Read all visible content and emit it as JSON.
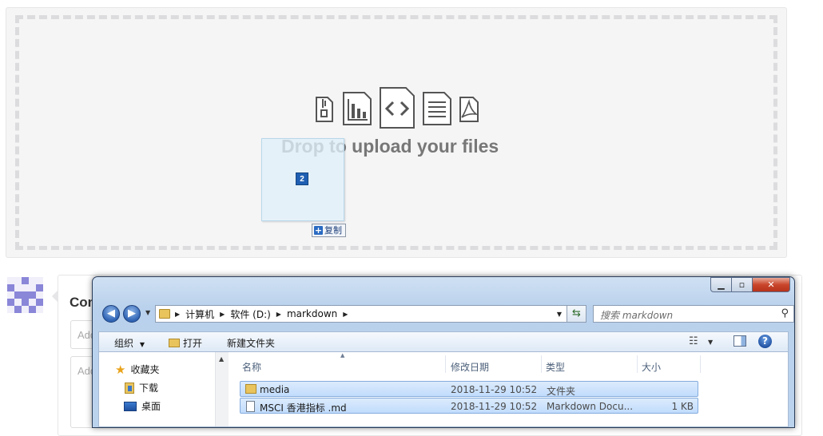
{
  "upload": {
    "drop_text": "Drop to upload your files",
    "drag_count": "2",
    "drag_action": "复制",
    "file_icons": [
      "zip-file-icon",
      "chart-file-icon",
      "code-file-icon",
      "text-file-icon",
      "pdf-file-icon"
    ]
  },
  "commit": {
    "title": "Commit changes",
    "summary_placeholder": "Add",
    "description_placeholder": "Add"
  },
  "explorer": {
    "breadcrumbs": [
      "计算机",
      "软件 (D:)",
      "markdown"
    ],
    "search_placeholder": "搜索 markdown",
    "toolbar": {
      "organize": "组织",
      "open": "打开",
      "new_folder": "新建文件夹"
    },
    "nav": {
      "favorites": "收藏夹",
      "downloads": "下载",
      "desktop": "桌面"
    },
    "columns": {
      "name": "名称",
      "date": "修改日期",
      "type": "类型",
      "size": "大小"
    },
    "files": [
      {
        "name": "media",
        "date": "2018-11-29 10:52",
        "type": "文件夹",
        "size": ""
      },
      {
        "name": "MSCI 香港指标 .md",
        "date": "2018-11-29 10:52",
        "type": "Markdown Docu...",
        "size": "1 KB"
      }
    ]
  },
  "colors": {
    "drop_bg": "#f5f5f6",
    "dash": "#dcdcde",
    "selection": "#c1dcfc",
    "avatar": "#8a86d8"
  }
}
